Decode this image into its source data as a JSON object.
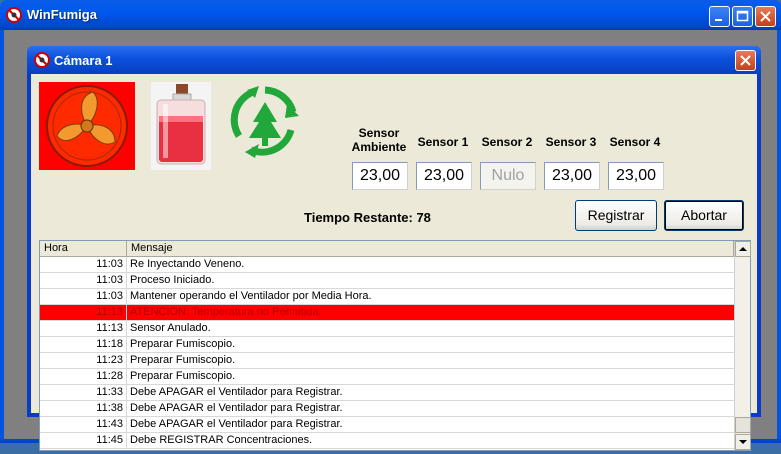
{
  "app": {
    "title": "WinFumiga"
  },
  "child": {
    "title": "Cámara 1"
  },
  "sensors": [
    {
      "label": "Sensor Ambiente",
      "value": "23,00",
      "disabled": false
    },
    {
      "label": "Sensor 1",
      "value": "23,00",
      "disabled": false
    },
    {
      "label": "Sensor 2",
      "value": "Nulo",
      "disabled": true
    },
    {
      "label": "Sensor 3",
      "value": "23,00",
      "disabled": false
    },
    {
      "label": "Sensor 4",
      "value": "23,00",
      "disabled": false
    }
  ],
  "status": {
    "tiempo_restante": "Tiempo Restante: 78"
  },
  "buttons": {
    "registrar": "Registrar",
    "abortar": "Abortar"
  },
  "log": {
    "columns": [
      "Hora",
      "Mensaje"
    ],
    "rows": [
      {
        "hora": "11:03",
        "mensaje": "Re Inyectando Veneno.",
        "alert": false
      },
      {
        "hora": "11:03",
        "mensaje": "Proceso Iniciado.",
        "alert": false
      },
      {
        "hora": "11:03",
        "mensaje": "Mantener operando el Ventilador por Media Hora.",
        "alert": false
      },
      {
        "hora": "11:13",
        "mensaje": "ATENCION: Temperatura no Permitida.",
        "alert": true
      },
      {
        "hora": "11:13",
        "mensaje": "Sensor Anulado.",
        "alert": false
      },
      {
        "hora": "11:18",
        "mensaje": "Preparar Fumiscopio.",
        "alert": false
      },
      {
        "hora": "11:23",
        "mensaje": "Preparar Fumiscopio.",
        "alert": false
      },
      {
        "hora": "11:28",
        "mensaje": "Preparar Fumiscopio.",
        "alert": false
      },
      {
        "hora": "11:33",
        "mensaje": "Debe APAGAR el Ventilador para Registrar.",
        "alert": false
      },
      {
        "hora": "11:38",
        "mensaje": "Debe APAGAR el Ventilador para Registrar.",
        "alert": false
      },
      {
        "hora": "11:43",
        "mensaje": "Debe APAGAR el Ventilador para Registrar.",
        "alert": false
      },
      {
        "hora": "11:45",
        "mensaje": "Debe REGISTRAR Concentraciones.",
        "alert": false
      }
    ]
  },
  "icons": {
    "app": "no-entry-icon",
    "fan": "fan-icon",
    "bottle": "poison-bottle-icon",
    "recycle": "recycle-tree-icon"
  },
  "colors": {
    "alert_row": "#ff0000",
    "fan_bg": "#ff0000",
    "recycle": "#22a83a"
  }
}
